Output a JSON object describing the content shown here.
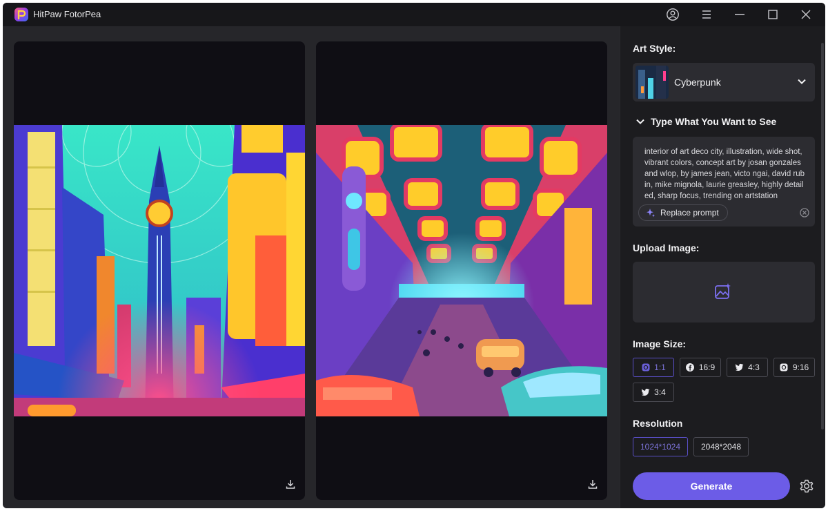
{
  "app": {
    "title": "HitPaw FotorPea"
  },
  "titlebar": {
    "icons": [
      "account-icon",
      "menu-icon",
      "minimize-icon",
      "maximize-icon",
      "close-icon"
    ]
  },
  "art_style": {
    "label": "Art Style:",
    "selected": "Cyberpunk"
  },
  "prompt": {
    "heading": "Type What You Want to See",
    "text": "interior of art deco city, illustration, wide shot, vibrant colors, concept art by josan gonzales and wlop, by james jean, victo ngai, david rubin, mike mignola, laurie greasley, highly detailed, sharp focus, trending on artstation",
    "replace_label": "Replace prompt"
  },
  "upload": {
    "label": "Upload Image:"
  },
  "image_size": {
    "label": "Image Size:",
    "options": [
      {
        "label": "1:1",
        "icon": "instagram-icon",
        "active": true
      },
      {
        "label": "16:9",
        "icon": "facebook-icon",
        "active": false
      },
      {
        "label": "4:3",
        "icon": "twitter-icon",
        "active": false
      },
      {
        "label": "9:16",
        "icon": "instagram-icon",
        "active": false
      },
      {
        "label": "3:4",
        "icon": "twitter-icon",
        "active": false
      }
    ]
  },
  "resolution": {
    "label": "Resolution",
    "options": [
      {
        "label": "1024*1024",
        "active": true
      },
      {
        "label": "2048*2048",
        "active": false
      }
    ]
  },
  "generate_label": "Generate",
  "colors": {
    "accent": "#6c5ce7",
    "panel": "#2c2c31",
    "background": "#1b1b1e"
  }
}
